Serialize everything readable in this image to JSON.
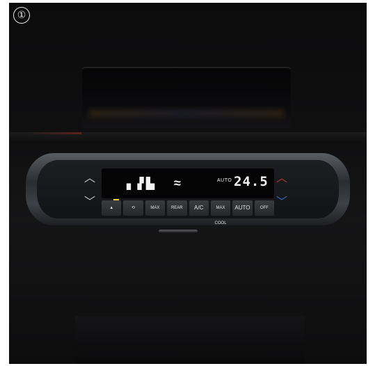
{
  "step_number": "①",
  "climate": {
    "fan_level": "▖▗▘▙",
    "mode_icon": "≈",
    "auto_label": "AUTO",
    "temperature": "24.5",
    "temp_up": "︿",
    "temp_down": "﹀",
    "fan_up": "︿",
    "fan_down": "﹀"
  },
  "buttons": [
    {
      "label": "▲",
      "name": "front-defrost"
    },
    {
      "label": "⟲",
      "name": "recirculation"
    },
    {
      "label": "MAX",
      "name": "max-defrost"
    },
    {
      "label": "REAR",
      "name": "rear-defrost"
    },
    {
      "label": "A/C",
      "name": "ac"
    },
    {
      "label": "MAX COOL",
      "name": "max-cool"
    },
    {
      "label": "AUTO",
      "name": "auto"
    },
    {
      "label": "OFF",
      "name": "off"
    }
  ],
  "colors": {
    "temp_up_accent": "#b83a3a",
    "temp_down_accent": "#3a6ccf",
    "indicator": "#f4d21a"
  }
}
